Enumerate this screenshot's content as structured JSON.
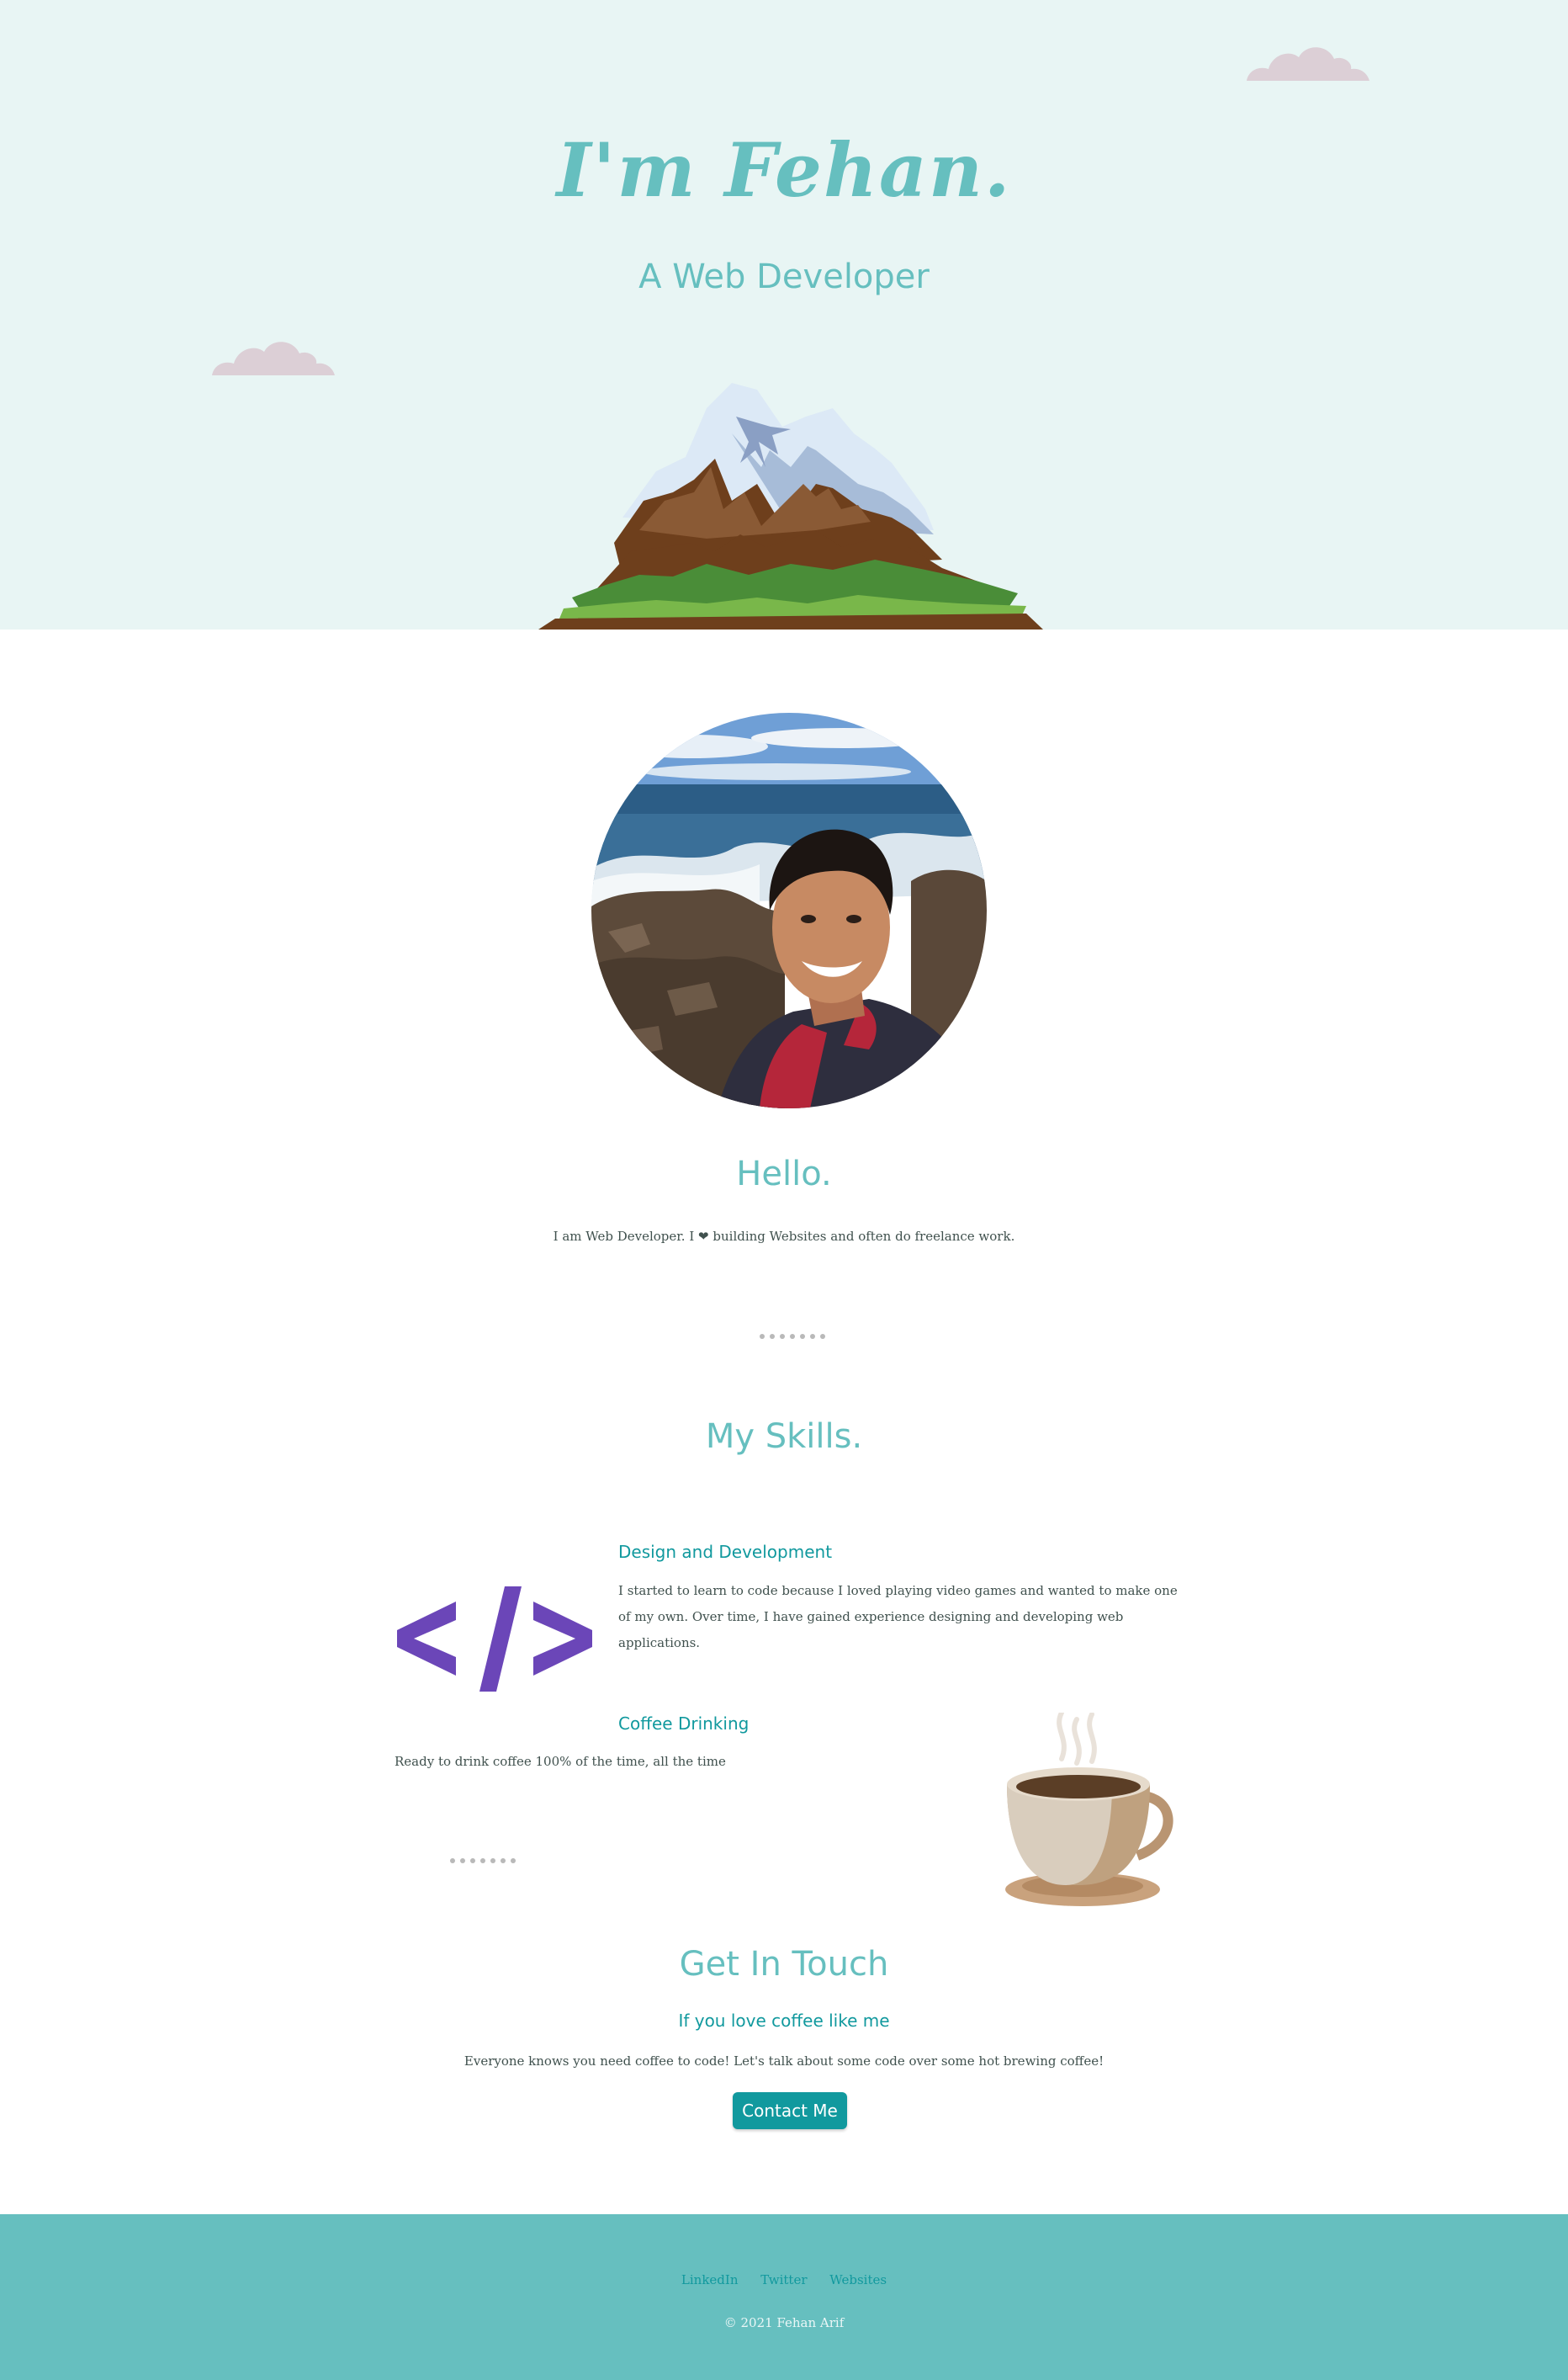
{
  "hero": {
    "title": "I'm Fehan.",
    "subtitle": "A Web Developer"
  },
  "icons": {
    "clouds": "cloud-icon",
    "mountain": "mountain-illustration",
    "code": "code-icon",
    "coffee": "coffee-cup-icon",
    "heart": "heart-icon"
  },
  "about": {
    "title": "Hello.",
    "text_before_heart": "I am Web Developer. I ",
    "text_after_heart": " building Websites and often do freelance work."
  },
  "skills": {
    "title": "My Skills.",
    "items": [
      {
        "heading": "Design and Development",
        "text": "I started to learn to code because I loved playing video games and wanted to make one of my own. Over time, I have gained experience designing and developing web applications."
      },
      {
        "heading": "Coffee Drinking",
        "text": "Ready to drink coffee 100% of the time, all the time"
      }
    ]
  },
  "contact": {
    "title": "Get In Touch",
    "subtitle": "If you love coffee like me",
    "text": "Everyone knows you need coffee to code! Let's talk about some code over some hot brewing coffee!",
    "button_label": "Contact Me"
  },
  "footer": {
    "links": [
      "LinkedIn",
      "Twitter",
      "Websites"
    ],
    "copyright": "© 2021 Fehan Arif"
  },
  "colors": {
    "hero_bg": "#e8f5f4",
    "accent": "#66bfbf",
    "heading_dark": "#11999e",
    "text": "#40514e",
    "footer_bg": "#66bfbf",
    "code_purple": "#6b46b8"
  }
}
